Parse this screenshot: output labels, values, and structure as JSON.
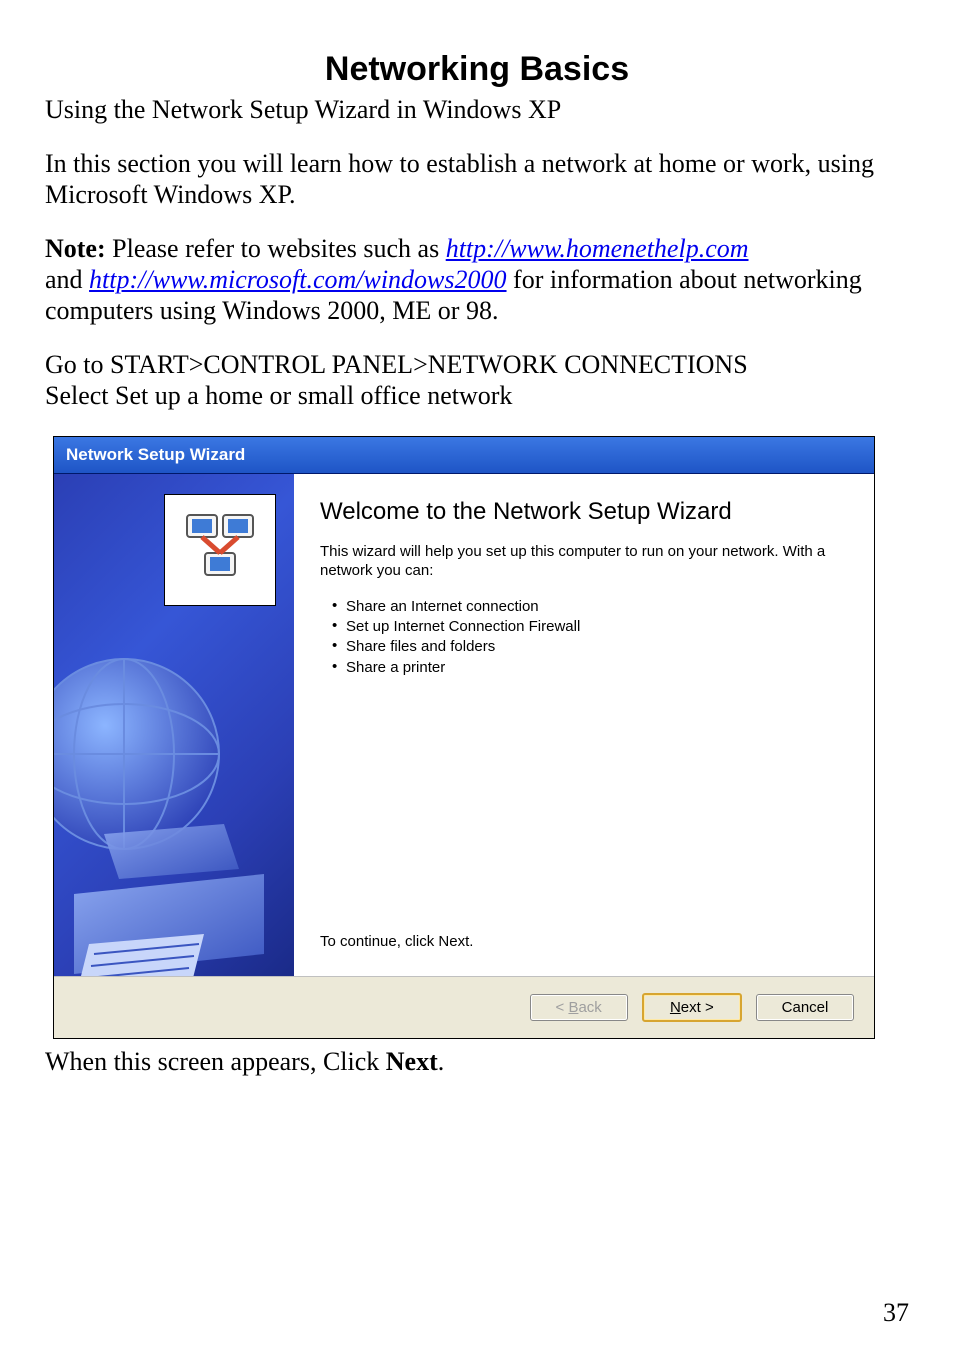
{
  "heading": "Networking Basics",
  "subheading": "Using the Network Setup Wizard in Windows XP",
  "intro_line1": "In this section you will learn how to establish a network at home or work, using Microsoft Windows XP.",
  "note_label": "Note:",
  "note_text_before_link": "  Please refer to websites such as ",
  "link1": "http://www.homenethelp.com",
  "note_text_between": "and ",
  "link2": "http://www.microsoft.com/windows2000",
  "note_text_after": "  for information about networking computers using Windows 2000, ME or 98.",
  "nav_line1": "Go to START>CONTROL PANEL>NETWORK CONNECTIONS",
  "nav_line2": "Select Set up a home or small office network",
  "dialog": {
    "titlebar": "Network Setup Wizard",
    "welcome_title": "Welcome to the Network Setup Wizard",
    "welcome_desc": "This wizard will help you set up this computer to run on your network. With a network you can:",
    "bullets": [
      "Share an Internet connection",
      "Set up Internet Connection Firewall",
      "Share files and folders",
      "Share a printer"
    ],
    "continue": "To continue, click Next.",
    "back_btn_pre": "< ",
    "back_btn_u": "B",
    "back_btn_post": "ack",
    "next_btn_u": "N",
    "next_btn_post": "ext >",
    "cancel_btn": "Cancel"
  },
  "post_text_before": "When this screen appears, Click ",
  "post_text_bold": "Next",
  "post_text_after": ".",
  "page_number": "37"
}
